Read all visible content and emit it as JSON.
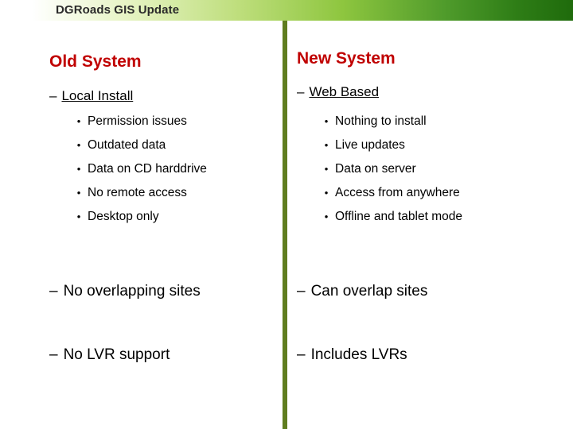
{
  "header": {
    "title": "DGRoads GIS Update"
  },
  "left": {
    "heading": "Old System",
    "sub1": {
      "dash": "–",
      "text": "Local Install"
    },
    "bullets": [
      "Permission issues",
      "Outdated data",
      "Data on CD harddrive",
      "No remote access",
      "Desktop only"
    ],
    "sub2": {
      "dash": "–",
      "text": "No overlapping sites"
    },
    "sub3": {
      "dash": "–",
      "text": "No LVR support"
    }
  },
  "right": {
    "heading": "New System",
    "sub1": {
      "dash": "–",
      "text": "Web Based"
    },
    "bullets": [
      "Nothing to install",
      "Live updates",
      "Data on server",
      "Access from anywhere",
      "Offline and tablet mode"
    ],
    "sub2": {
      "dash": "–",
      "text": "Can overlap sites"
    },
    "sub3": {
      "dash": "–",
      "text": "Includes LVRs"
    }
  },
  "bullet_glyph": "•",
  "colors": {
    "heading": "#c00000",
    "divider": "#5f7d1f",
    "band_green": "#8ec63f"
  }
}
